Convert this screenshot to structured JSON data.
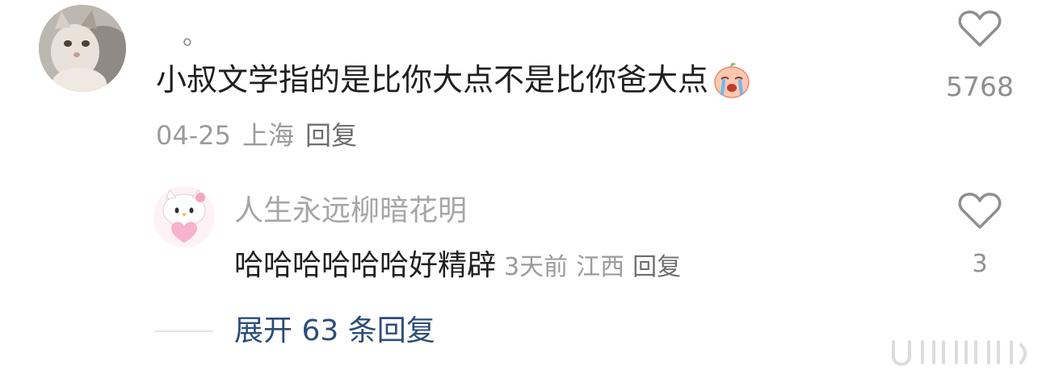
{
  "main_comment": {
    "username": "。",
    "text": "小叔文学指的是比你大点不是比你爸大点",
    "emoji": "crying-peach-emoji",
    "date": "04-25",
    "location": "上海",
    "reply_label": "回复",
    "like_count": "5768"
  },
  "reply_comment": {
    "username": "人生永远柳暗花明",
    "text": "哈哈哈哈哈哈好精辟",
    "time": "3天前",
    "location": "江西",
    "reply_label": "回复",
    "like_count": "3"
  },
  "expand": {
    "label": "展开 63 条回复"
  },
  "icons": {
    "like": "heart-outline-icon"
  },
  "colors": {
    "link": "#2c4d7a",
    "meta": "#9b9b9b",
    "text": "#1f1f1f"
  }
}
